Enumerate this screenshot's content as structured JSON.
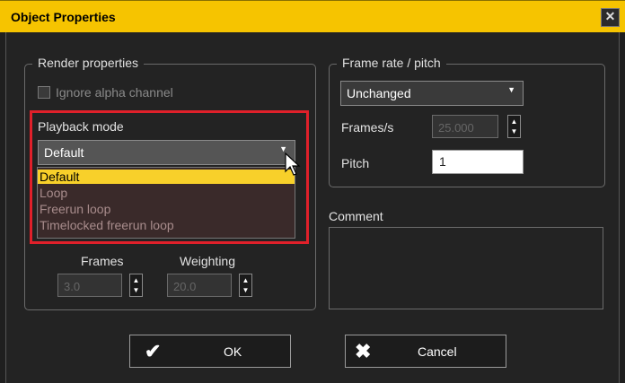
{
  "window": {
    "title": "Object Properties",
    "close_glyph": "✕"
  },
  "render": {
    "legend": "Render properties",
    "ignore_alpha_label": "Ignore alpha channel",
    "playback_label": "Playback mode",
    "playback_value": "Default",
    "playback_options": [
      "Default",
      "Loop",
      "Freerun loop",
      "Timelocked freerun loop"
    ],
    "selected_index": 0,
    "frames_label": "Frames",
    "frames_value": "3.0",
    "weighting_label": "Weighting",
    "weighting_value": "20.0"
  },
  "framerate": {
    "legend": "Frame rate / pitch",
    "mode_value": "Unchanged",
    "fps_label": "Frames/s",
    "fps_value": "25.000",
    "pitch_label": "Pitch",
    "pitch_value": "1"
  },
  "comment": {
    "label": "Comment",
    "value": ""
  },
  "buttons": {
    "ok_label": "OK",
    "cancel_label": "Cancel",
    "ok_icon": "✔",
    "cancel_icon": "✖"
  },
  "colors": {
    "accent": "#f6c400",
    "highlight": "#e0202a",
    "selection": "#f8d02a"
  }
}
